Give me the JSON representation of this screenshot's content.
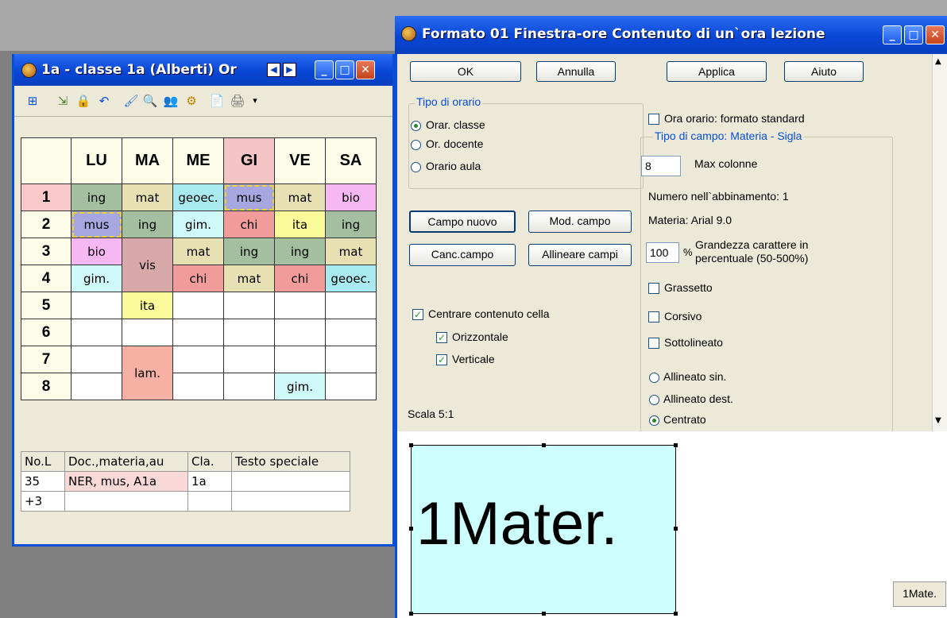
{
  "window1": {
    "title": "1a - classe 1a (Alberti)  Or",
    "timetable": {
      "days": [
        "LU",
        "MA",
        "ME",
        "GI",
        "VE",
        "SA"
      ],
      "periods": [
        "1",
        "2",
        "3",
        "4",
        "5",
        "6",
        "7",
        "8"
      ],
      "cells": {
        "r1": [
          "ing",
          "mat",
          "geoec.",
          "mus",
          "mat",
          "bio"
        ],
        "r2": [
          "mus",
          "ing",
          "gim.",
          "chi",
          "ita",
          "ing"
        ],
        "r3": [
          "bio",
          "vis",
          "mat",
          "ing",
          "ing",
          "mat"
        ],
        "r4": [
          "gim.",
          "",
          "chi",
          "mat",
          "chi",
          "geoec."
        ],
        "r5": [
          "",
          "ita",
          "",
          "",
          "",
          ""
        ],
        "r7": [
          "",
          "lam.",
          "",
          "",
          "",
          ""
        ],
        "r8": [
          "",
          "",
          "",
          "",
          "gim.",
          ""
        ]
      }
    },
    "details": {
      "headers": [
        "No.L",
        "Doc.,materia,au",
        "Cla.",
        "Testo speciale"
      ],
      "rows": [
        [
          "35",
          "NER, mus, A1a",
          "1a",
          ""
        ],
        [
          "+3",
          "",
          "",
          ""
        ]
      ]
    }
  },
  "window2": {
    "title": "Formato 01  Finestra-ore  Contenuto di un`ora lezione",
    "buttons": {
      "ok": "OK",
      "cancel": "Annulla",
      "apply": "Applica",
      "help": "Aiuto"
    },
    "tipo_orario": {
      "legend": "Tipo di orario",
      "options": [
        "Orar. classe",
        "Or. docente",
        "Orario aula"
      ]
    },
    "field_buttons": {
      "new": "Campo nuovo",
      "modify": "Mod. campo",
      "delete": "Canc.campo",
      "align": "Allineare campi"
    },
    "center": {
      "main": "Centrare contenuto cella",
      "horizontal": "Orizzontale",
      "vertical": "Verticale"
    },
    "scale": "Scala  5:1",
    "standard_format": "Ora orario: formato standard",
    "field_type": {
      "legend": "Tipo di campo: Materia - Sigla",
      "max_columns_value": "8",
      "max_columns_label": "Max colonne",
      "pairing": "Numero nell`abbinamento: 1",
      "font": "Materia: Arial 9.0",
      "size_value": "100",
      "percent": "%",
      "size_label_1": "Grandezza carattere in",
      "size_label_2": "percentuale (50-500%)",
      "bold": "Grassetto",
      "italic": "Corsivo",
      "underline": "Sottolineato",
      "align_left": "Allineato sin.",
      "align_right": "Allineato dest.",
      "centered": "Centrato"
    },
    "preview": {
      "text": "1Mater.",
      "mini": "1Mate."
    }
  },
  "colors": {
    "ing": "#a3bfa0",
    "mat": "#e7e0b3",
    "geoec": "#a9eaf0",
    "mus": "#a6a6e0",
    "bio": "#f7b7f3",
    "gim": "#cff9f9",
    "chi": "#f29b9b",
    "ita": "#fafa9a",
    "vis": "#d9a8a8",
    "lam": "#f6b0a4",
    "rownum": "#f9c8c8",
    "gi_header": "#f5c4c4",
    "preview_bg": "#ccfffe"
  }
}
